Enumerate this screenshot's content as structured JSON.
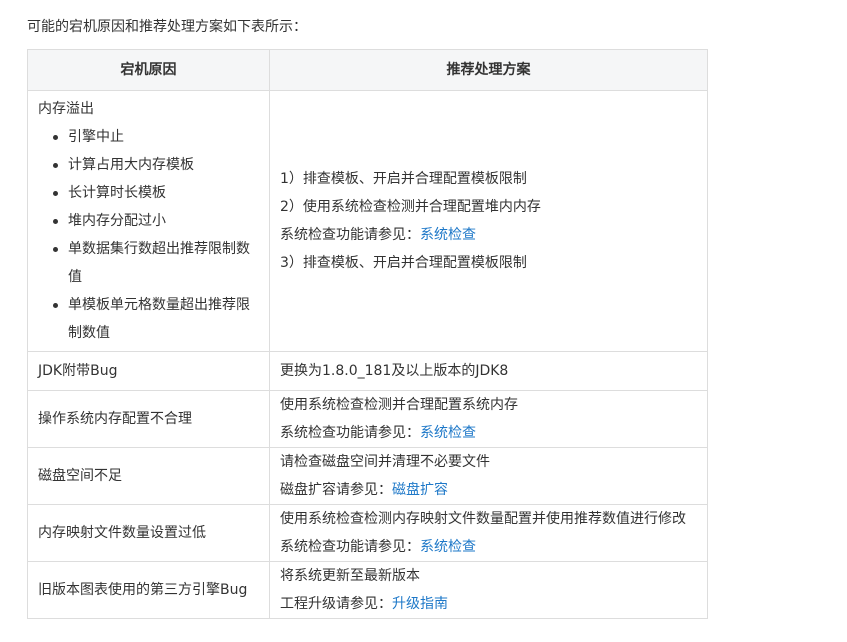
{
  "intro": "可能的宕机原因和推荐处理方案如下表所示：",
  "table": {
    "headers": [
      "宕机原因",
      "推荐处理方案"
    ],
    "rows": [
      {
        "cause_title": "内存溢出",
        "cause_items": [
          "引擎中止",
          "计算占用大内存模板",
          "长计算时长模板",
          "堆内存分配过小",
          "单数据集行数超出推荐限制数值",
          "单模板单元格数量超出推荐限制数值"
        ],
        "solution": [
          "1）排查模板、开启并合理配置模板限制",
          "2）使用系统检查检测并合理配置堆内内存"
        ],
        "ref_prefix": "系统检查功能请参见：",
        "ref_link": "系统检查",
        "solution_after": "3）排查模板、开启并合理配置模板限制"
      },
      {
        "cause_title": "JDK附带Bug",
        "solution": [
          "更换为1.8.0_181及以上版本的JDK8"
        ]
      },
      {
        "cause_title": "操作系统内存配置不合理",
        "solution": [
          "使用系统检查检测并合理配置系统内存"
        ],
        "ref_prefix": "系统检查功能请参见：",
        "ref_link": "系统检查"
      },
      {
        "cause_title": "磁盘空间不足",
        "solution": [
          "请检查磁盘空间并清理不必要文件"
        ],
        "ref_prefix": "磁盘扩容请参见：",
        "ref_link": "磁盘扩容"
      },
      {
        "cause_title": "内存映射文件数量设置过低",
        "solution": [
          "使用系统检查检测内存映射文件数量配置并使用推荐数值进行修改"
        ],
        "ref_prefix": "系统检查功能请参见：",
        "ref_link": "系统检查"
      },
      {
        "cause_title": "旧版本图表使用的第三方引擎Bug",
        "solution": [
          "将系统更新至最新版本"
        ],
        "ref_prefix": "工程升级请参见：",
        "ref_link": "升级指南"
      }
    ]
  }
}
